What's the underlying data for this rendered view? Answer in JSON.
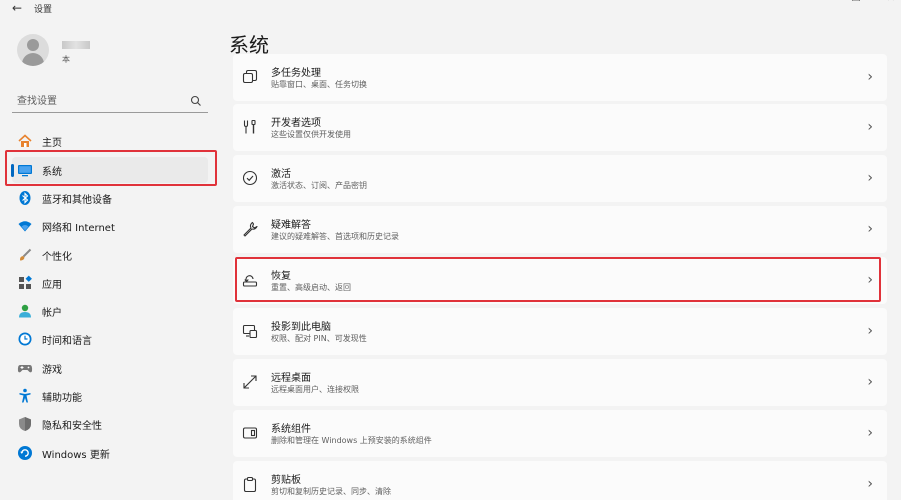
{
  "window": {
    "title": "设置",
    "back_symbol": "←",
    "min_symbol": "—",
    "max_symbol": "❐",
    "close_symbol": "✕"
  },
  "user": {
    "sub": "本"
  },
  "search": {
    "placeholder": "查找设置"
  },
  "sidebar": {
    "items": [
      {
        "label": "主页",
        "icon": "home-icon",
        "color": "#e8822e"
      },
      {
        "label": "系统",
        "icon": "system-display-icon",
        "color": "#0078d4",
        "active": true
      },
      {
        "label": "蓝牙和其他设备",
        "icon": "bluetooth-icon",
        "color": "#0078d4"
      },
      {
        "label": "网络和 Internet",
        "icon": "wifi-icon",
        "color": "#0078d4"
      },
      {
        "label": "个性化",
        "icon": "brush-icon",
        "color": "#d18b3a"
      },
      {
        "label": "应用",
        "icon": "apps-icon",
        "color": "#555555"
      },
      {
        "label": "帐户",
        "icon": "account-icon",
        "color": "#2ea043"
      },
      {
        "label": "时间和语言",
        "icon": "time-language-icon",
        "color": "#0078d4"
      },
      {
        "label": "游戏",
        "icon": "gamepad-icon",
        "color": "#666666"
      },
      {
        "label": "辅助功能",
        "icon": "accessibility-icon",
        "color": "#0078d4"
      },
      {
        "label": "隐私和安全性",
        "icon": "shield-icon",
        "color": "#777777"
      },
      {
        "label": "Windows 更新",
        "icon": "update-icon",
        "color": "#0078d4"
      }
    ]
  },
  "main": {
    "title": "系统",
    "cards": [
      {
        "title": "多任务处理",
        "sub": "贴靠窗口、桌面、任务切换",
        "icon": "multitasking-icon"
      },
      {
        "title": "开发者选项",
        "sub": "这些设置仅供开发使用",
        "icon": "developer-tools-icon"
      },
      {
        "title": "激活",
        "sub": "激活状态、订阅、产品密钥",
        "icon": "activation-check-icon"
      },
      {
        "title": "疑难解答",
        "sub": "建议的疑难解答、首选项和历史记录",
        "icon": "wrench-icon"
      },
      {
        "title": "恢复",
        "sub": "重置、高级启动、返回",
        "icon": "recovery-icon"
      },
      {
        "title": "投影到此电脑",
        "sub": "权限、配对 PIN、可发现性",
        "icon": "project-to-pc-icon"
      },
      {
        "title": "远程桌面",
        "sub": "远程桌面用户、连接权限",
        "icon": "remote-desktop-icon"
      },
      {
        "title": "系统组件",
        "sub": "删除和管理在 Windows 上预安装的系统组件",
        "icon": "system-components-icon"
      },
      {
        "title": "剪贴板",
        "sub": "剪切和复制历史记录、同步、清除",
        "icon": "clipboard-icon"
      }
    ],
    "chevron": "›"
  },
  "highlight_color": "#e0323a"
}
